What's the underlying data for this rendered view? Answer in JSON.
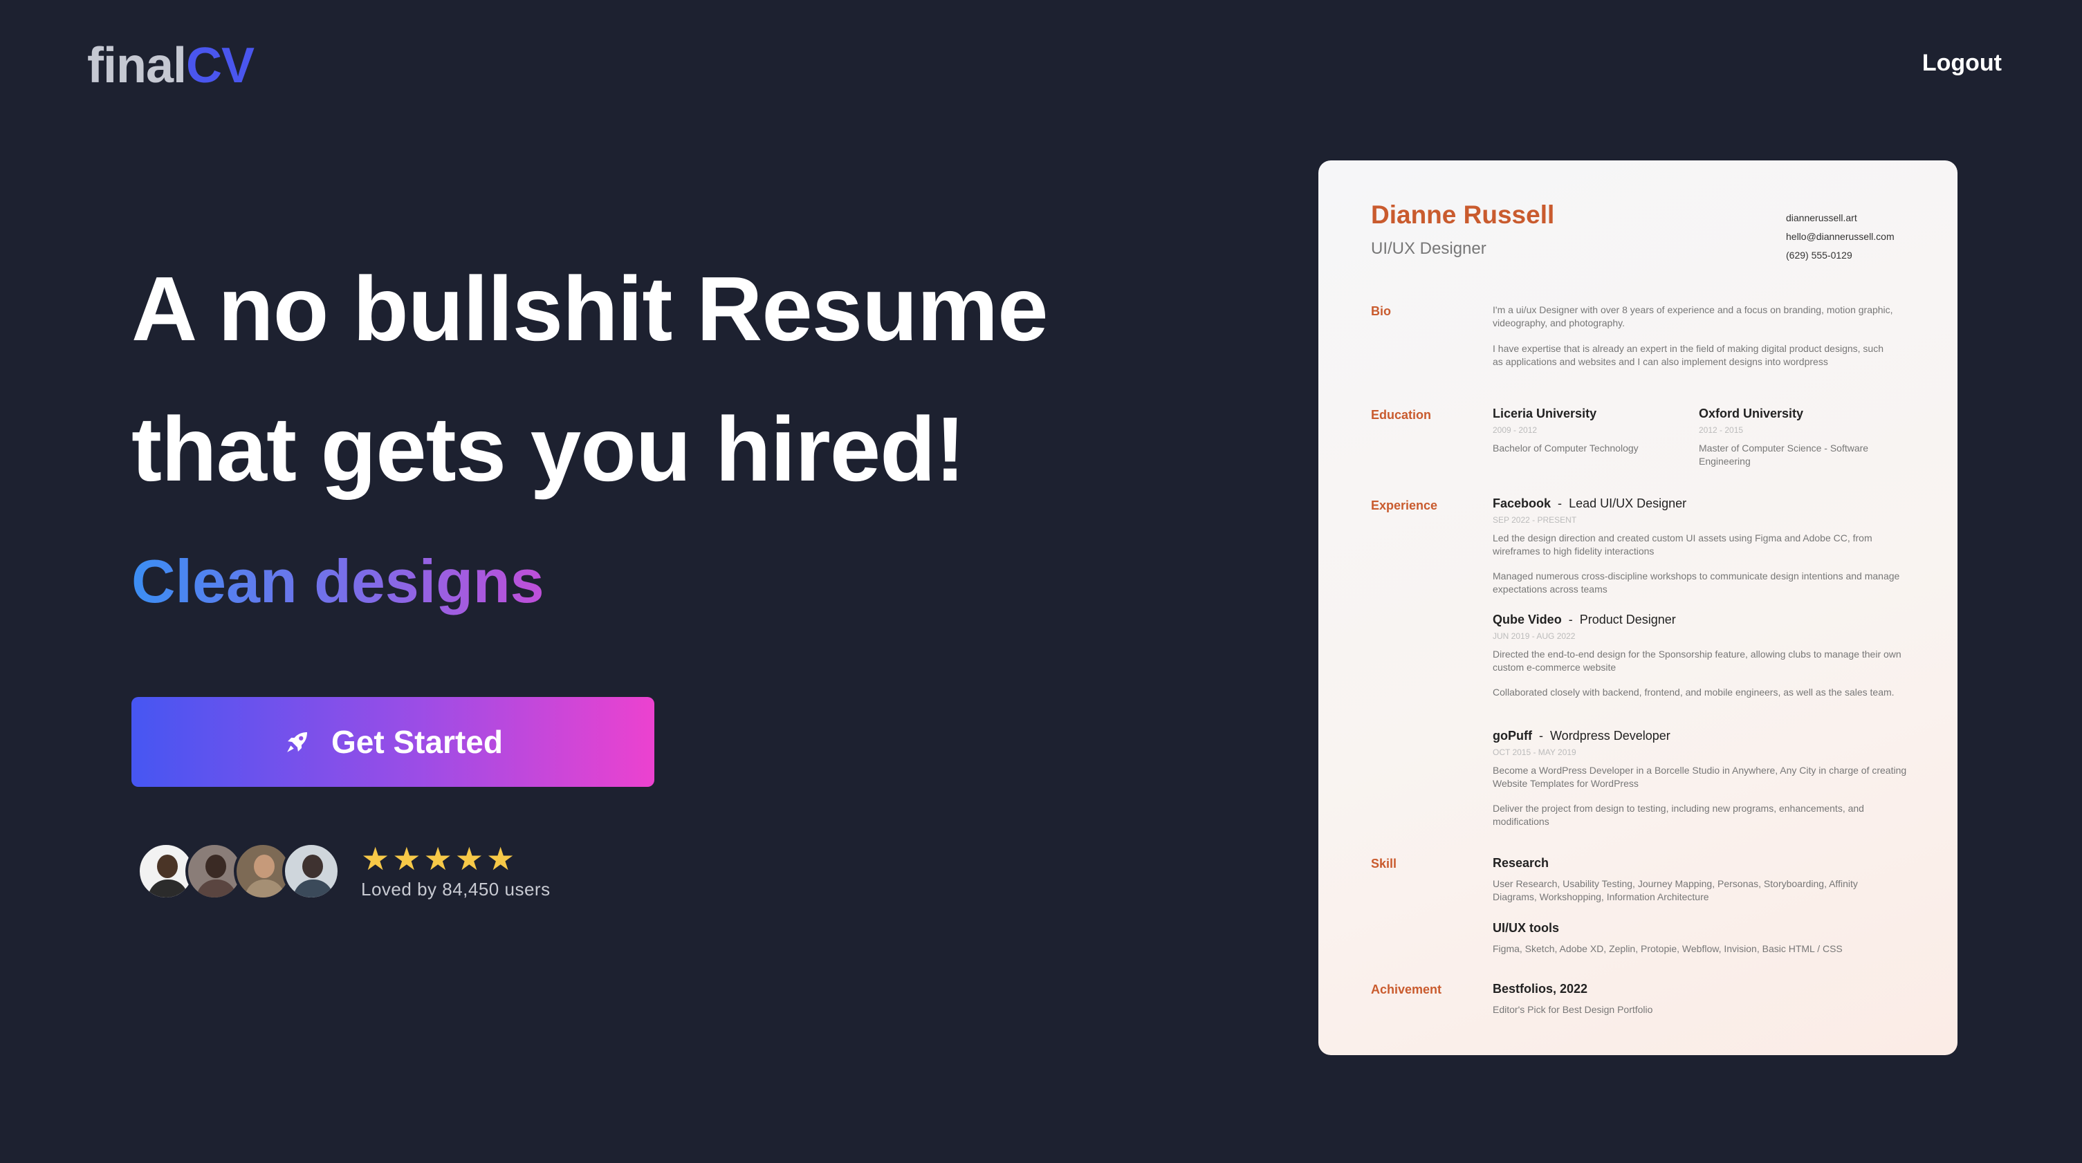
{
  "header": {
    "logo_part1": "final",
    "logo_part2": "CV",
    "logout_label": "Logout"
  },
  "hero": {
    "headline_line1": "A no bullshit Resume",
    "headline_line2": "that gets you hired!",
    "subheadline": "Clean designs",
    "cta_label": "Get Started",
    "loved_text": "Loved by 84,450 users",
    "rating": 5
  },
  "resume": {
    "name": "Dianne Russell",
    "title": "UI/UX Designer",
    "contact": {
      "website": "diannerussell.art",
      "email": "hello@diannerussell.com",
      "phone": "(629) 555-0129"
    },
    "bio": {
      "label": "Bio",
      "para1": "I'm a ui/ux Designer with over 8 years of experience and a focus on branding, motion graphic, videography, and photography.",
      "para2": "I have expertise that is already an expert in the field of making digital product designs, such as applications and websites and I can also implement designs into wordpress"
    },
    "education": {
      "label": "Education",
      "items": [
        {
          "school": "Liceria University",
          "years": "2009 - 2012",
          "degree": "Bachelor of Computer Technology"
        },
        {
          "school": "Oxford University",
          "years": "2012 - 2015",
          "degree": "Master of Computer Science - Software Engineering"
        }
      ]
    },
    "experience": {
      "label": "Experience",
      "items": [
        {
          "company": "Facebook",
          "sep": "-",
          "role": "Lead UI/UX Designer",
          "dates": "SEP 2022 - PRESENT",
          "p1": "Led the design direction and created custom UI assets using Figma and Adobe CC, from wireframes to high fidelity interactions",
          "p2": "Managed numerous cross-discipline workshops to communicate design intentions and manage expectations across teams"
        },
        {
          "company": "Qube Video",
          "sep": "-",
          "role": "Product Designer",
          "dates": "JUN 2019 - AUG 2022",
          "p1": "Directed the end-to-end design for the Sponsorship feature, allowing clubs to manage their own custom e-commerce website",
          "p2": "Collaborated closely with backend, frontend, and mobile engineers, as well as the sales team."
        },
        {
          "company": "goPuff",
          "sep": "-",
          "role": "Wordpress Developer",
          "dates": "OCT 2015 - MAY 2019",
          "p1": "Become a WordPress Developer in a Borcelle Studio in Anywhere, Any City in charge of creating Website Templates for WordPress",
          "p2": "Deliver the project from design to testing, including new programs, enhancements, and modifications"
        }
      ]
    },
    "skill": {
      "label": "Skill",
      "items": [
        {
          "name": "Research",
          "desc": "User Research, Usability Testing, Journey Mapping, Personas, Storyboarding, Affinity Diagrams, Workshopping, Information Architecture"
        },
        {
          "name": "UI/UX tools",
          "desc": "Figma, Sketch, Adobe XD, Zeplin, Protopie, Webflow, Invision, Basic HTML / CSS"
        }
      ]
    },
    "achievement": {
      "label": "Achivement",
      "title": "Bestfolios, 2022",
      "desc": "Editor's Pick for Best Design Portfolio"
    }
  },
  "colors": {
    "background": "#1d2130",
    "brand_blue": "#4a56ee",
    "resume_accent": "#c95b2e",
    "star": "#f7c948"
  },
  "icons": {
    "cta_icon": "rocket-icon",
    "rating_icon": "star-icon"
  }
}
